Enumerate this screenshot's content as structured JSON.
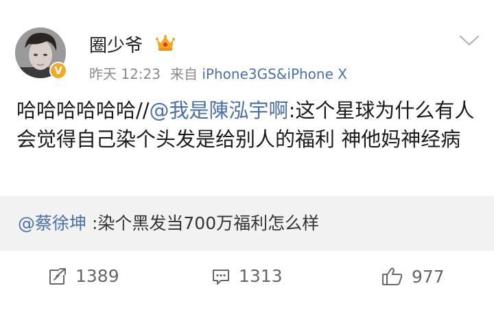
{
  "post": {
    "author": {
      "name": "圈少爷"
    },
    "meta": {
      "time": "昨天 12:23",
      "source_prefix": "来自",
      "source_device": "iPhone3GS&iPhone X"
    },
    "text": {
      "main": "哈哈哈哈哈哈//",
      "mention": "@我是陳泓宇啊",
      "quoted": ":这个星球为什么有人会觉得自己染个头发是给别人的福利 神他妈神经病"
    },
    "retweet": {
      "mention": "@蔡徐坤",
      "text": " :染个黑发当700万福利怎么样"
    },
    "actions": {
      "reposts": "1389",
      "comments": "1313",
      "likes": "977"
    }
  },
  "colors": {
    "link": "#4a70a8",
    "muted": "#8a8a8a",
    "verified_badge": "#f5a623",
    "retweet_bg": "#f2f2f2"
  },
  "icons": {
    "vip": "vip-crown-icon",
    "verified": "verified-v-icon",
    "more": "chevron-down-icon",
    "repost": "repost-icon",
    "comment": "comment-icon",
    "like": "thumbs-up-icon"
  }
}
